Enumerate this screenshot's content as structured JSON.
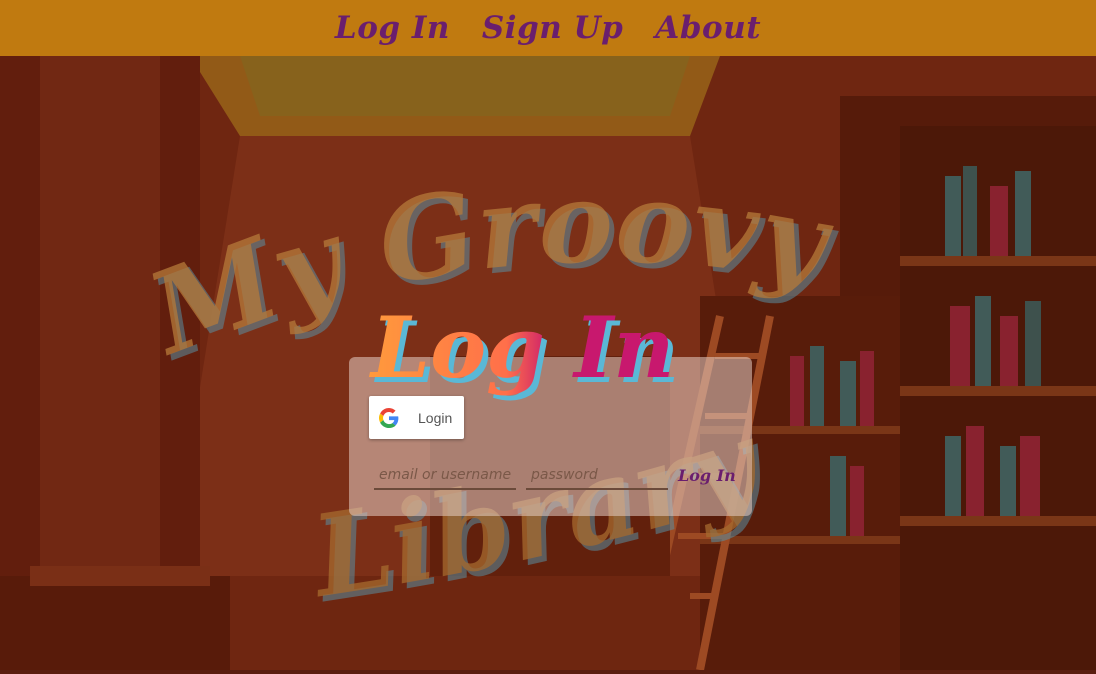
{
  "nav": {
    "links": [
      {
        "label": "Log In"
      },
      {
        "label": "Sign Up"
      },
      {
        "label": "About"
      }
    ]
  },
  "hero": {
    "background_title_line1": "My Groovy",
    "background_title_line2": "Library"
  },
  "login": {
    "heading": "Log In",
    "google_label": "Login",
    "email_placeholder": "email or username",
    "password_placeholder": "password",
    "submit_label": "Log In"
  },
  "colors": {
    "nav_bg": "#c07a10",
    "nav_text": "#6a1e6e",
    "heading_orange": "#ff9a3c",
    "heading_pink": "#c8186e",
    "heading_shadow": "#5ab8d6"
  }
}
